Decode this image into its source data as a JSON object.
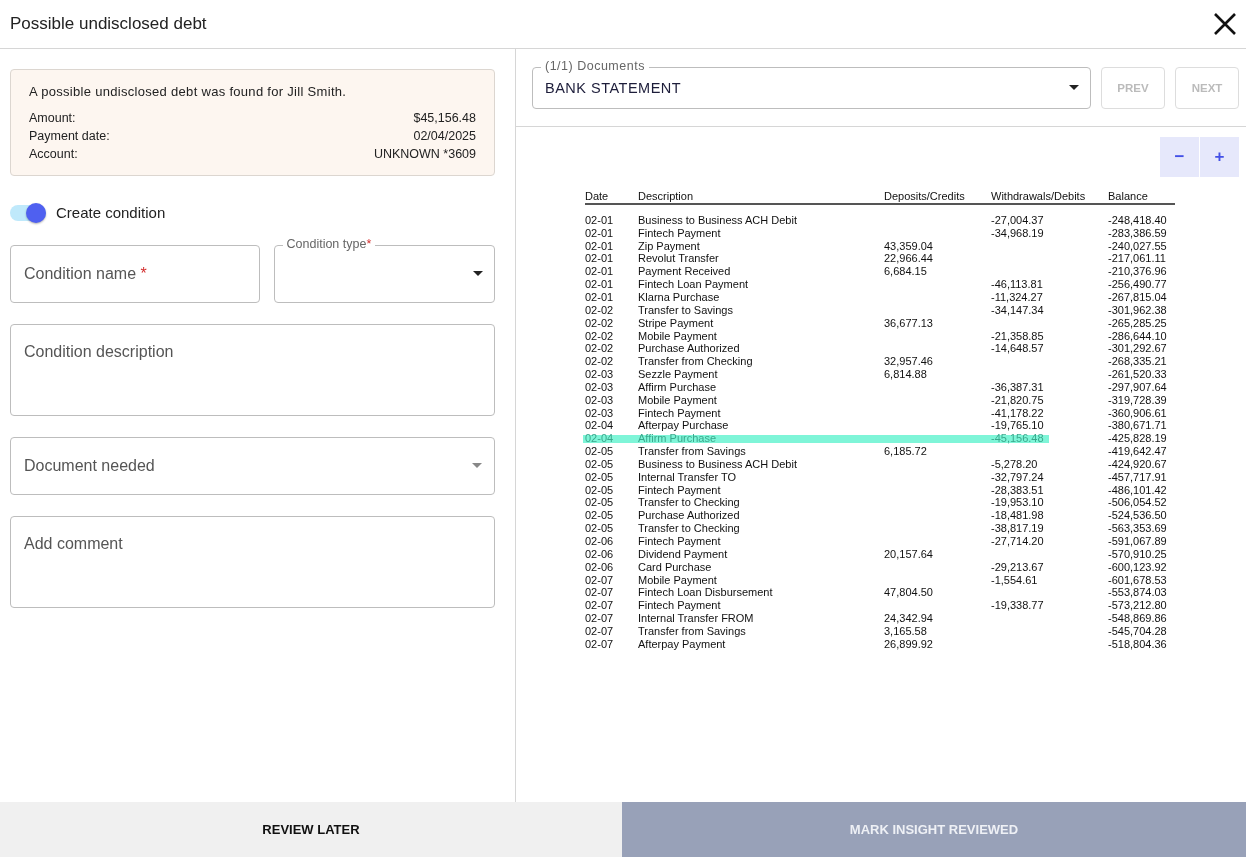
{
  "window": {
    "title": "Possible undisclosed debt"
  },
  "alert": {
    "message": "A possible undisclosed debt was found for Jill Smith.",
    "details": [
      {
        "label": "Amount:",
        "value": "$45,156.48"
      },
      {
        "label": "Payment date:",
        "value": "02/04/2025"
      },
      {
        "label": "Account:",
        "value": "UNKNOWN *3609"
      }
    ]
  },
  "toggle": {
    "label": "Create condition",
    "on": true
  },
  "form_rows": [
    [
      {
        "kind": "text",
        "placeholder": "Condition name",
        "required_mark": "*"
      },
      {
        "kind": "select",
        "label": "Condition type",
        "required_mark": "*"
      }
    ],
    [
      {
        "kind": "textarea",
        "placeholder": "Condition description"
      }
    ],
    [
      {
        "kind": "dropdown",
        "placeholder": "Document needed"
      }
    ],
    [
      {
        "kind": "textarea",
        "placeholder": "Add comment"
      }
    ]
  ],
  "document_picker": {
    "label": "(1/1) Documents",
    "value": "BANK STATEMENT"
  },
  "nav_buttons": [
    {
      "label": "PREV",
      "disabled": true
    },
    {
      "label": "NEXT",
      "disabled": true
    }
  ],
  "zoom_buttons": [
    "−",
    "+"
  ],
  "statement": {
    "columns": [
      "Date",
      "Description",
      "Deposits/Credits",
      "Withdrawals/Debits",
      "Balance"
    ],
    "rows": [
      {
        "cells": [
          "02-01",
          "Business to Business ACH Debit",
          "",
          "-27,004.37",
          "-248,418.40"
        ],
        "highlighted": false
      },
      {
        "cells": [
          "02-01",
          "Fintech Payment",
          "",
          "-34,968.19",
          "-283,386.59"
        ],
        "highlighted": false
      },
      {
        "cells": [
          "02-01",
          "Zip Payment",
          "43,359.04",
          "",
          "-240,027.55"
        ],
        "highlighted": false
      },
      {
        "cells": [
          "02-01",
          "Revolut Transfer",
          "22,966.44",
          "",
          "-217,061.11"
        ],
        "highlighted": false
      },
      {
        "cells": [
          "02-01",
          "Payment Received",
          "6,684.15",
          "",
          "-210,376.96"
        ],
        "highlighted": false
      },
      {
        "cells": [
          "02-01",
          "Fintech Loan Payment",
          "",
          "-46,113.81",
          "-256,490.77"
        ],
        "highlighted": false
      },
      {
        "cells": [
          "02-01",
          "Klarna Purchase",
          "",
          "-11,324.27",
          "-267,815.04"
        ],
        "highlighted": false
      },
      {
        "cells": [
          "02-02",
          "Transfer to Savings",
          "",
          "-34,147.34",
          "-301,962.38"
        ],
        "highlighted": false
      },
      {
        "cells": [
          "02-02",
          "Stripe Payment",
          "36,677.13",
          "",
          "-265,285.25"
        ],
        "highlighted": false
      },
      {
        "cells": [
          "02-02",
          "Mobile Payment",
          "",
          "-21,358.85",
          "-286,644.10"
        ],
        "highlighted": false
      },
      {
        "cells": [
          "02-02",
          "Purchase Authorized",
          "",
          "-14,648.57",
          "-301,292.67"
        ],
        "highlighted": false
      },
      {
        "cells": [
          "02-02",
          "Transfer from Checking",
          "32,957.46",
          "",
          "-268,335.21"
        ],
        "highlighted": false
      },
      {
        "cells": [
          "02-03",
          "Sezzle Payment",
          "6,814.88",
          "",
          "-261,520.33"
        ],
        "highlighted": false
      },
      {
        "cells": [
          "02-03",
          "Affirm Purchase",
          "",
          "-36,387.31",
          "-297,907.64"
        ],
        "highlighted": false
      },
      {
        "cells": [
          "02-03",
          "Mobile Payment",
          "",
          "-21,820.75",
          "-319,728.39"
        ],
        "highlighted": false
      },
      {
        "cells": [
          "02-03",
          "Fintech Payment",
          "",
          "-41,178.22",
          "-360,906.61"
        ],
        "highlighted": false
      },
      {
        "cells": [
          "02-04",
          "Afterpay Purchase",
          "",
          "-19,765.10",
          "-380,671.71"
        ],
        "highlighted": false
      },
      {
        "cells": [
          "02-04",
          "Affirm Purchase",
          "",
          "-45,156.48",
          "-425,828.19"
        ],
        "highlighted": true
      },
      {
        "cells": [
          "02-05",
          "Transfer from Savings",
          "6,185.72",
          "",
          "-419,642.47"
        ],
        "highlighted": false
      },
      {
        "cells": [
          "02-05",
          "Business to Business ACH Debit",
          "",
          "-5,278.20",
          "-424,920.67"
        ],
        "highlighted": false
      },
      {
        "cells": [
          "02-05",
          "Internal Transfer TO",
          "",
          "-32,797.24",
          "-457,717.91"
        ],
        "highlighted": false
      },
      {
        "cells": [
          "02-05",
          "Fintech Payment",
          "",
          "-28,383.51",
          "-486,101.42"
        ],
        "highlighted": false
      },
      {
        "cells": [
          "02-05",
          "Transfer to Checking",
          "",
          "-19,953.10",
          "-506,054.52"
        ],
        "highlighted": false
      },
      {
        "cells": [
          "02-05",
          "Purchase Authorized",
          "",
          "-18,481.98",
          "-524,536.50"
        ],
        "highlighted": false
      },
      {
        "cells": [
          "02-05",
          "Transfer to Checking",
          "",
          "-38,817.19",
          "-563,353.69"
        ],
        "highlighted": false
      },
      {
        "cells": [
          "02-06",
          "Fintech Payment",
          "",
          "-27,714.20",
          "-591,067.89"
        ],
        "highlighted": false
      },
      {
        "cells": [
          "02-06",
          "Dividend Payment",
          "20,157.64",
          "",
          "-570,910.25"
        ],
        "highlighted": false
      },
      {
        "cells": [
          "02-06",
          "Card Purchase",
          "",
          "-29,213.67",
          "-600,123.92"
        ],
        "highlighted": false
      },
      {
        "cells": [
          "02-07",
          "Mobile Payment",
          "",
          "-1,554.61",
          "-601,678.53"
        ],
        "highlighted": false
      },
      {
        "cells": [
          "02-07",
          "Fintech Loan Disbursement",
          "47,804.50",
          "",
          "-553,874.03"
        ],
        "highlighted": false
      },
      {
        "cells": [
          "02-07",
          "Fintech Payment",
          "",
          "-19,338.77",
          "-573,212.80"
        ],
        "highlighted": false
      },
      {
        "cells": [
          "02-07",
          "Internal Transfer FROM",
          "24,342.94",
          "",
          "-548,869.86"
        ],
        "highlighted": false
      },
      {
        "cells": [
          "02-07",
          "Transfer from Savings",
          "3,165.58",
          "",
          "-545,704.28"
        ],
        "highlighted": false
      },
      {
        "cells": [
          "02-07",
          "Afterpay Payment",
          "26,899.92",
          "",
          "-518,804.36"
        ],
        "highlighted": false
      }
    ]
  },
  "footer_buttons": [
    {
      "label": "REVIEW LATER",
      "kind": "secondary"
    },
    {
      "label": "MARK INSIGHT REVIEWED",
      "kind": "primary"
    }
  ]
}
